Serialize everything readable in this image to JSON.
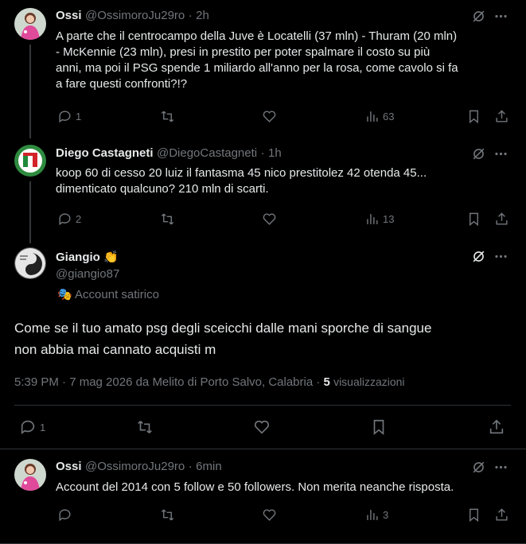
{
  "tweets": [
    {
      "name": "Ossi",
      "handle": "@OssimoroJu29ro",
      "time": "2h",
      "text_lines": [
        "A parte che il centrocampo della Juve è Locatelli (37 mln) - Thuram (20 mln)",
        "- McKennie (23 mln), presi in prestito per poter spalmare il costo su più",
        "anni, ma poi il PSG spende 1 miliardo all'anno per la rosa, come cavolo si fa",
        "a fare questi confronti?!?"
      ],
      "replies": "1",
      "views": "63"
    },
    {
      "name": "Diego Castagneti",
      "handle": "@DiegoCastagneti",
      "time": "1h",
      "text_lines": [
        "koop 60 di cesso 20 luiz il fantasma 45 nico prestitolez 42 otenda 45...",
        "dimenticato qualcuno?  210 mln di scarti."
      ],
      "replies": "2",
      "views": "13"
    }
  ],
  "main_tweet": {
    "name": "Giangio",
    "name_emoji": "👏",
    "handle": "@giangio87",
    "label_emoji": "🎭",
    "label": "Account satirico",
    "text_lines": [
      "Come se il tuo amato psg degli sceicchi dalle mani sporche di sangue",
      "non abbia mai cannato acquisti m"
    ],
    "timestamp": "5:39 PM · 7 mag 2026 da Melito di Porto Salvo, Calabria ·",
    "views_count": "5",
    "views_label": "visualizzazioni",
    "replies": "1"
  },
  "reply": {
    "name": "Ossi",
    "handle": "@OssimoroJu29ro",
    "time": "6min",
    "text": "Account del 2014 con 5 follow e 50 followers. Non merita neanche risposta.",
    "views": "3"
  },
  "sep": "·",
  "colors": {
    "bg": "#000000",
    "text": "#e7e9ea",
    "muted": "#71767b",
    "border": "#2f3336"
  }
}
